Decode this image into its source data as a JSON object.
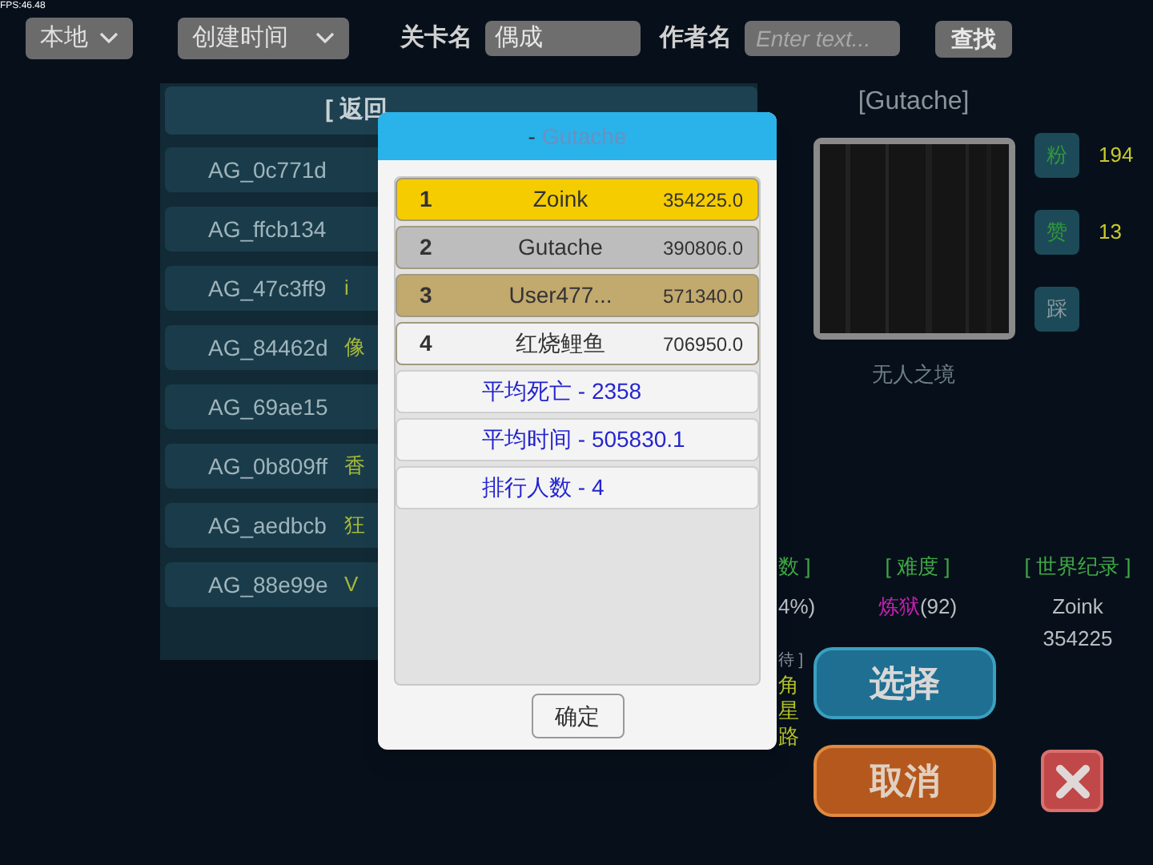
{
  "fps": "FPS:46.48",
  "toolbar": {
    "source_dropdown": "本地",
    "sort_dropdown": "创建时间",
    "level_name_label": "关卡名",
    "level_name_value": "偶成",
    "author_label": "作者名",
    "author_placeholder": "Enter text...",
    "search_button": "查找"
  },
  "level_list": {
    "header": "[ 返回",
    "rows": [
      {
        "id": "AG_0c771d"
      },
      {
        "id": "AG_ffcb134"
      },
      {
        "id": "AG_47c3ff9",
        "column_2": "i"
      },
      {
        "id": "AG_84462d",
        "column_2": "像"
      },
      {
        "id": "AG_69ae15"
      },
      {
        "id": "AG_0b809ff",
        "column_2": "香"
      },
      {
        "id": "AG_aedbcb",
        "column_2": "狂"
      },
      {
        "id": "AG_88e99e",
        "column_2": "V"
      }
    ]
  },
  "detail": {
    "author": "[Gutache]",
    "level_title": "无人之境",
    "reactions": [
      {
        "label": "粉",
        "count": "194",
        "active": true
      },
      {
        "label": "赞",
        "count": "13",
        "active": true
      },
      {
        "label": "踩",
        "active": false
      }
    ],
    "stats": {
      "column_1": {
        "header": "数 ]",
        "value": "4%)"
      },
      "difficulty": {
        "header": "[ 难度 ]",
        "level_name": "炼狱",
        "value": "(92)"
      },
      "world_record": {
        "header": "[ 世界纪录 ]",
        "holder": "Zoink",
        "time": "354225"
      }
    },
    "tag_column": {
      "header": "待 ]",
      "lines": [
        "角",
        "星",
        "路"
      ]
    },
    "select_button": "选择",
    "cancel_button": "取消"
  },
  "leaderboard": {
    "title_prefix": "- ",
    "title_name": "Gutache",
    "entries": [
      {
        "rank": "1",
        "name": "Zoink",
        "score": "354225.0",
        "color": "#f5cc00"
      },
      {
        "rank": "2",
        "name": "Gutache",
        "score": "390806.0",
        "color": "#bdbdbd"
      },
      {
        "rank": "3",
        "name": "User477...",
        "score": "571340.0",
        "color": "#c2a96e"
      },
      {
        "rank": "4",
        "name": "红烧鲤鱼",
        "score": "706950.0",
        "color": "#f2f2f2"
      }
    ],
    "summary": [
      "平均死亡 - 2358",
      "平均时间 - 505830.1",
      "排行人数 - 4"
    ],
    "ok_button": "确定"
  }
}
